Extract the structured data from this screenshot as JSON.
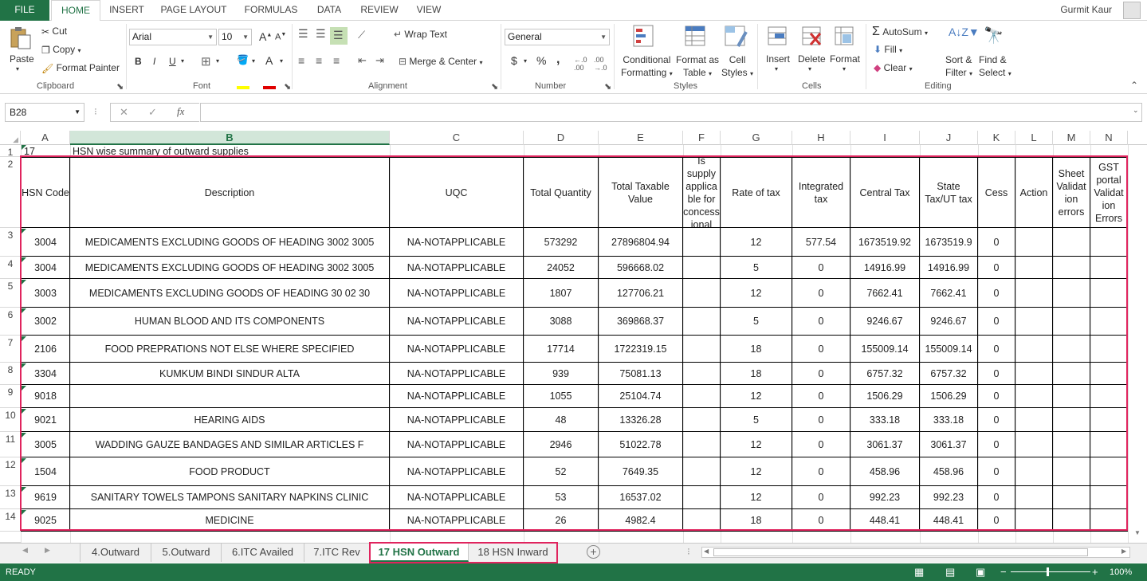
{
  "ribbon_tabs": [
    "FILE",
    "HOME",
    "INSERT",
    "PAGE LAYOUT",
    "FORMULAS",
    "DATA",
    "REVIEW",
    "VIEW"
  ],
  "user_name": "Gurmit Kaur",
  "clipboard": {
    "paste": "Paste",
    "cut": "Cut",
    "copy": "Copy",
    "format_painter": "Format Painter",
    "label": "Clipboard"
  },
  "font": {
    "name": "Arial",
    "size": "10",
    "bold": "B",
    "italic": "I",
    "underline": "U",
    "label": "Font",
    "grow": "A",
    "shrink": "A"
  },
  "alignment": {
    "wrap_text": "Wrap Text",
    "merge_center": "Merge & Center",
    "label": "Alignment"
  },
  "number": {
    "format": "General",
    "currency": "$",
    "percent": "%",
    "comma": ",",
    "label": "Number"
  },
  "styles": {
    "conditional": "Conditional",
    "formatting": "Formatting",
    "format_as": "Format as",
    "table": "Table",
    "cell": "Cell",
    "cell_styles": "Styles",
    "label": "Styles"
  },
  "cells": {
    "insert": "Insert",
    "delete": "Delete",
    "format": "Format",
    "label": "Cells"
  },
  "editing": {
    "autosum": "AutoSum",
    "fill": "Fill",
    "clear": "Clear",
    "sort": "Sort &",
    "filter": "Filter",
    "find": "Find &",
    "select": "Select",
    "label": "Editing"
  },
  "formula_bar": {
    "name_box": "B28",
    "fx": "fx",
    "cancel": "✕",
    "enter": "✓",
    "content": ""
  },
  "columns": [
    "A",
    "B",
    "C",
    "D",
    "E",
    "F",
    "G",
    "H",
    "I",
    "J",
    "K",
    "L",
    "M",
    "N"
  ],
  "row1": {
    "num": "1",
    "a": "17",
    "b": "HSN wise summary of outward supplies"
  },
  "header_row": {
    "num": "2",
    "cells": [
      "HSN Code",
      "Description",
      "UQC",
      "Total Quantity",
      "Total Taxable Value",
      "Is supply applica ble for concess ional",
      "Rate of tax",
      "Integrated tax",
      "Central Tax",
      "State Tax/UT tax",
      "Cess",
      "Action",
      "Sheet Validat ion errors",
      "GST portal Validat ion Errors"
    ]
  },
  "rows": [
    {
      "num": "3",
      "cells": [
        "3004",
        "MEDICAMENTS  EXCLUDING GOODS OF HEADING 3002  3005",
        "NA-NOTAPPLICABLE",
        "573292",
        "27896804.94",
        "",
        "12",
        "577.54",
        "1673519.92",
        "1673519.9",
        "0",
        "",
        "",
        ""
      ]
    },
    {
      "num": "4",
      "cells": [
        "3004",
        "MEDICAMENTS  EXCLUDING GOODS OF HEADING 3002  3005",
        "NA-NOTAPPLICABLE",
        "24052",
        "596668.02",
        "",
        "5",
        "0",
        "14916.99",
        "14916.99",
        "0",
        "",
        "",
        ""
      ]
    },
    {
      "num": "5",
      "cells": [
        "3003",
        "MEDICAMENTS  EXCLUDING GOODS OF HEADING 30 02  30",
        "NA-NOTAPPLICABLE",
        "1807",
        "127706.21",
        "",
        "12",
        "0",
        "7662.41",
        "7662.41",
        "0",
        "",
        "",
        ""
      ]
    },
    {
      "num": "6",
      "cells": [
        "3002",
        "HUMAN   BLOOD AND ITS COMPONENTS",
        "NA-NOTAPPLICABLE",
        "3088",
        "369868.37",
        "",
        "5",
        "0",
        "9246.67",
        "9246.67",
        "0",
        "",
        "",
        ""
      ]
    },
    {
      "num": "7",
      "cells": [
        "2106",
        "FOOD PREPRATIONS NOT ELSE WHERE SPECIFIED",
        "NA-NOTAPPLICABLE",
        "17714",
        "1722319.15",
        "",
        "18",
        "0",
        "155009.14",
        "155009.14",
        "0",
        "",
        "",
        ""
      ]
    },
    {
      "num": "8",
      "cells": [
        "3304",
        "KUMKUM  BINDI   SINDUR  ALTA",
        "NA-NOTAPPLICABLE",
        "939",
        "75081.13",
        "",
        "18",
        "0",
        "6757.32",
        "6757.32",
        "0",
        "",
        "",
        ""
      ]
    },
    {
      "num": "9",
      "cells": [
        "9018",
        "",
        "NA-NOTAPPLICABLE",
        "1055",
        "25104.74",
        "",
        "12",
        "0",
        "1506.29",
        "1506.29",
        "0",
        "",
        "",
        ""
      ]
    },
    {
      "num": "10",
      "cells": [
        "9021",
        "HEARING AIDS",
        "NA-NOTAPPLICABLE",
        "48",
        "13326.28",
        "",
        "5",
        "0",
        "333.18",
        "333.18",
        "0",
        "",
        "",
        ""
      ]
    },
    {
      "num": "11",
      "cells": [
        "3005",
        "WADDING  GAUZE  BANDAGES AND SIMILAR  ARTICLES   F",
        "NA-NOTAPPLICABLE",
        "2946",
        "51022.78",
        "",
        "12",
        "0",
        "3061.37",
        "3061.37",
        "0",
        "",
        "",
        ""
      ]
    },
    {
      "num": "12",
      "cells": [
        "1504",
        "FOOD PRODUCT",
        "NA-NOTAPPLICABLE",
        "52",
        "7649.35",
        "",
        "12",
        "0",
        "458.96",
        "458.96",
        "0",
        "",
        "",
        ""
      ]
    },
    {
      "num": "13",
      "cells": [
        "9619",
        "SANITARY TOWELS  TAMPONS  SANITARY NAPKINS  CLINIC",
        "NA-NOTAPPLICABLE",
        "53",
        "16537.02",
        "",
        "12",
        "0",
        "992.23",
        "992.23",
        "0",
        "",
        "",
        ""
      ]
    },
    {
      "num": "14",
      "cells": [
        "9025",
        "MEDICINE",
        "NA-NOTAPPLICABLE",
        "26",
        "4982.4",
        "",
        "18",
        "0",
        "448.41",
        "448.41",
        "0",
        "",
        "",
        ""
      ]
    }
  ],
  "sheet_tabs": [
    "4.Outward",
    "5.Outward",
    "6.ITC Availed",
    "7.ITC Rev",
    "17 HSN Outward",
    "18 HSN Inward"
  ],
  "active_sheet": "17 HSN Outward",
  "status": {
    "ready": "READY",
    "zoom": "100%"
  },
  "colors": {
    "excel_green": "#217346",
    "highlight": "#e0245e"
  }
}
